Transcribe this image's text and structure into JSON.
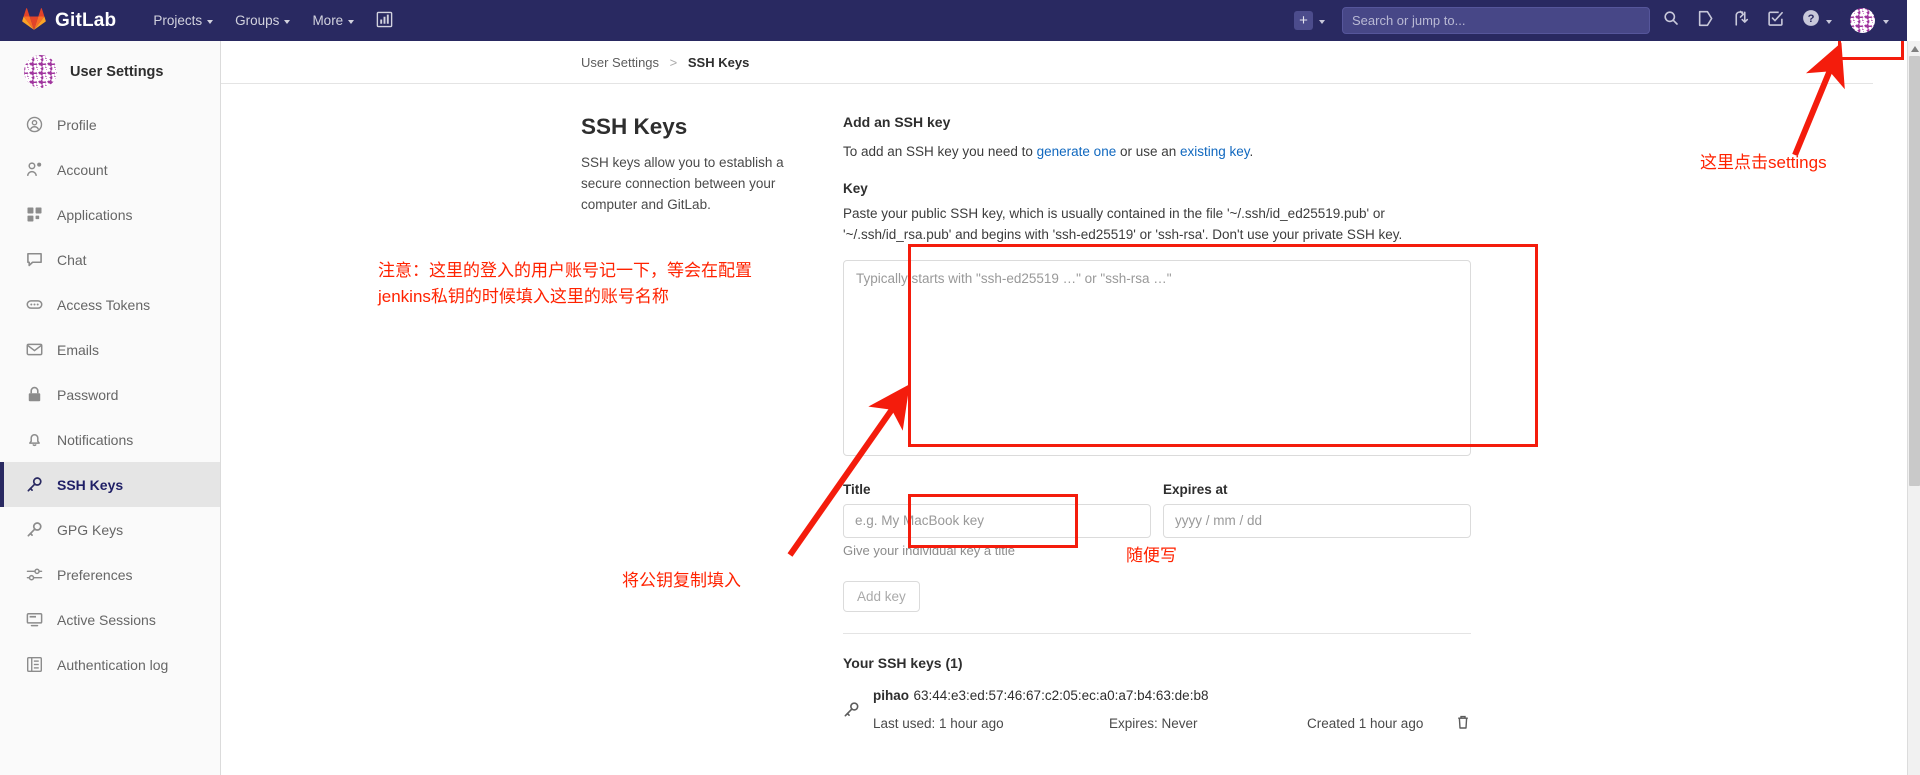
{
  "navbar": {
    "brand": "GitLab",
    "items": [
      {
        "label": "Projects",
        "name": "nav-projects",
        "caret": true
      },
      {
        "label": "Groups",
        "name": "nav-groups",
        "caret": true
      },
      {
        "label": "More",
        "name": "nav-more",
        "caret": true
      }
    ],
    "analytics_icon": "chart-bar-icon",
    "plus_icon": "plus-square-icon",
    "search": {
      "placeholder": "Search or jump to...",
      "icon": "search-icon"
    },
    "right_icons": [
      {
        "name": "issues-icon",
        "label": "Issues"
      },
      {
        "name": "merge-requests-icon",
        "label": "Merge requests"
      },
      {
        "name": "todos-icon",
        "label": "To-Do list"
      },
      {
        "name": "help-icon",
        "label": "Help"
      }
    ],
    "avatar": {
      "name": "user-avatar",
      "label": "User menu"
    }
  },
  "sidebar": {
    "title": "User Settings",
    "items": [
      {
        "label": "Profile",
        "icon": "user-circle-icon",
        "active": false
      },
      {
        "label": "Account",
        "icon": "account-gear-icon",
        "active": false
      },
      {
        "label": "Applications",
        "icon": "applications-grid-icon",
        "active": false
      },
      {
        "label": "Chat",
        "icon": "chat-bubble-icon",
        "active": false
      },
      {
        "label": "Access Tokens",
        "icon": "token-icon",
        "active": false
      },
      {
        "label": "Emails",
        "icon": "envelope-icon",
        "active": false
      },
      {
        "label": "Password",
        "icon": "lock-icon",
        "active": false
      },
      {
        "label": "Notifications",
        "icon": "bell-icon",
        "active": false
      },
      {
        "label": "SSH Keys",
        "icon": "key-icon",
        "active": true
      },
      {
        "label": "GPG Keys",
        "icon": "key-icon",
        "active": false
      },
      {
        "label": "Preferences",
        "icon": "sliders-icon",
        "active": false
      },
      {
        "label": "Active Sessions",
        "icon": "monitor-icon",
        "active": false
      },
      {
        "label": "Authentication log",
        "icon": "log-list-icon",
        "active": false
      }
    ]
  },
  "breadcrumb": {
    "root": "User Settings",
    "separator": ">",
    "current": "SSH Keys"
  },
  "intro": {
    "heading": "SSH Keys",
    "body": "SSH keys allow you to establish a secure connection between your computer and GitLab."
  },
  "form": {
    "heading": "Add an SSH key",
    "desc_1": "To add an SSH key you need to ",
    "link_generate": "generate one",
    "desc_2": " or use an ",
    "link_existing": "existing key",
    "desc_3": ".",
    "key_label": "Key",
    "key_help": "Paste your public SSH key, which is usually contained in the file '~/.ssh/id_ed25519.pub' or '~/.ssh/id_rsa.pub' and begins with 'ssh-ed25519' or 'ssh-rsa'. Don't use your private SSH key.",
    "key_placeholder": "Typically starts with \"ssh-ed25519 …\" or \"ssh-rsa …\"",
    "key_value": "",
    "title_label": "Title",
    "title_placeholder": "e.g. My MacBook key",
    "title_value": "",
    "title_hint": "Give your individual key a title",
    "expires_label": "Expires at",
    "expires_placeholder": "yyyy / mm / dd",
    "expires_value": "",
    "submit_label": "Add key"
  },
  "keys_list": {
    "heading": "Your SSH keys (1)",
    "rows": [
      {
        "icon": "key-icon",
        "name": "pihao",
        "fingerprint": "63:44:e3:ed:57:46:67:c2:05:ec:a0:a7:b4:63:de:b8",
        "last_used": "Last used: 1 hour ago",
        "expires": "Expires: Never",
        "created": "Created 1 hour ago",
        "delete_icon": "trash-icon"
      }
    ]
  },
  "annotations": [
    {
      "name": "annotation-account-note",
      "text": "注意：这里的登入的用户账号记一下，等会在配置\njenkins私钥的时候填入这里的账号名称"
    },
    {
      "name": "annotation-paste-pubkey",
      "text": "将公钥复制填入"
    },
    {
      "name": "annotation-anything",
      "text": "随便写"
    },
    {
      "name": "annotation-click-settings",
      "text": "这里点击settings"
    }
  ],
  "colors": {
    "navbar_bg": "#292961",
    "accent_red": "#f41c0c",
    "link_blue": "#1068bf",
    "sidebar_active": "#e5e5e5"
  }
}
